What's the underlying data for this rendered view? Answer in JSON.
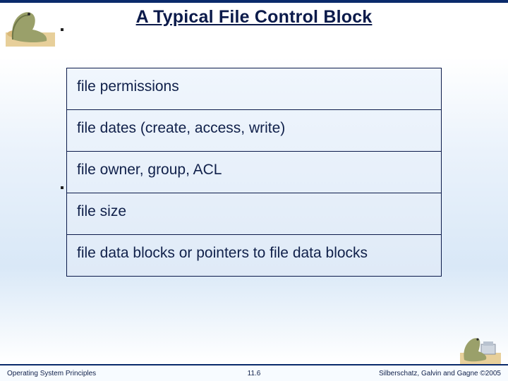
{
  "title": "A Typical File Control Block",
  "diagram": {
    "rows": [
      "file permissions",
      "file dates (create, access, write)",
      "file owner, group, ACL",
      "file size",
      "file data blocks or pointers to file data blocks"
    ]
  },
  "footer": {
    "left": "Operating System Principles",
    "center": "11.6",
    "right": "Silberschatz, Galvin and Gagne ©2005"
  },
  "colors": {
    "rule": "#0a2a6b",
    "text": "#10204a"
  }
}
